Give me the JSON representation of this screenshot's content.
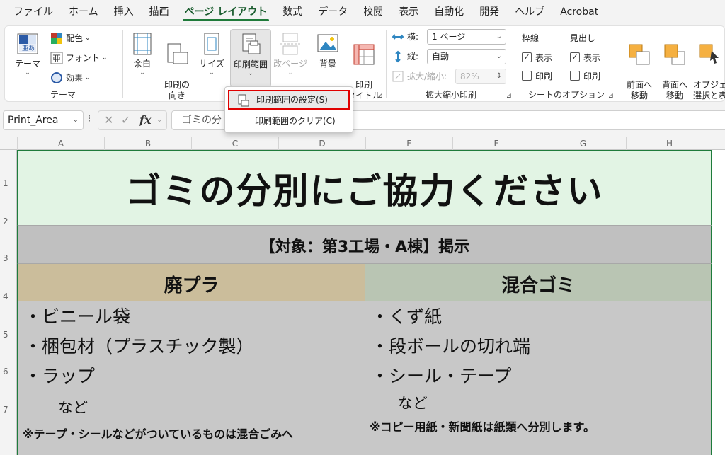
{
  "menu_tabs": [
    "ファイル",
    "ホーム",
    "挿入",
    "描画",
    "ページ レイアウト",
    "数式",
    "データ",
    "校閲",
    "表示",
    "自動化",
    "開発",
    "ヘルプ",
    "Acrobat"
  ],
  "active_tab": "ページ レイアウト",
  "ribbon": {
    "theme": {
      "theme_label": "テーマ",
      "colors_label": "配色",
      "fonts_label": "フォント",
      "effects_label": "効果",
      "group_label": "テーマ"
    },
    "page_setup": {
      "margins_label": "余白",
      "orientation_label": "印刷の\n向き",
      "size_label": "サイズ",
      "print_area_label": "印刷範囲",
      "breaks_label": "改ページ",
      "background_label": "背景",
      "print_titles_label": "印刷\nタイトル"
    },
    "scale_to_fit": {
      "width_label": "横:",
      "width_value": "1 ページ",
      "height_label": "縦:",
      "height_value": "自動",
      "scale_label": "拡大/縮小:",
      "scale_value": "82%",
      "group_label": "拡大縮小印刷"
    },
    "sheet_options": {
      "gridlines_label": "枠線",
      "headings_label": "見出し",
      "view_label": "表示",
      "print_label": "印刷",
      "gridlines_view": true,
      "gridlines_print": false,
      "headings_view": true,
      "headings_print": false,
      "group_label": "シートのオプション"
    },
    "arrange": {
      "bring_forward_label": "前面へ\n移動",
      "send_backward_label": "背面へ\n移動",
      "selection_pane_label": "オブジェク\n選択と表"
    }
  },
  "print_area_menu": {
    "set_label": "印刷範囲の設定(S)",
    "clear_label": "印刷範囲のクリア(C)"
  },
  "formula_bar": {
    "name_box": "Print_Area",
    "fx": "fx",
    "content": "ゴミの分"
  },
  "columns": [
    "A",
    "B",
    "C",
    "D",
    "E",
    "F",
    "G",
    "H"
  ],
  "rows": [
    "1",
    "2",
    "3",
    "4",
    "5",
    "6",
    "7"
  ],
  "sheet": {
    "title": "ゴミの分別にご協力ください",
    "subtitle": "【対象：第3工場・A棟】掲示",
    "left_header": "廃プラ",
    "right_header": "混合ゴミ",
    "left_items": [
      "・ビニール袋",
      "・梱包材（プラスチック製）",
      "・ラップ"
    ],
    "left_etc": "など",
    "left_note": "※テープ・シールなどがついているものは混合ごみへ",
    "right_items": [
      "・くず紙",
      "・段ボールの切れ端",
      "・シール・テープ"
    ],
    "right_etc": "など",
    "right_note": "※コピー用紙・新聞紙は紙類へ分別します。"
  },
  "colors": {
    "accent_green": "#1f7a3a",
    "title_bg": "#e2f4e4",
    "subtitle_bg": "#c0c0c0",
    "left_header_bg": "#cbbd9b",
    "right_header_bg": "#b9c5b3",
    "highlight_border": "#e00000"
  }
}
